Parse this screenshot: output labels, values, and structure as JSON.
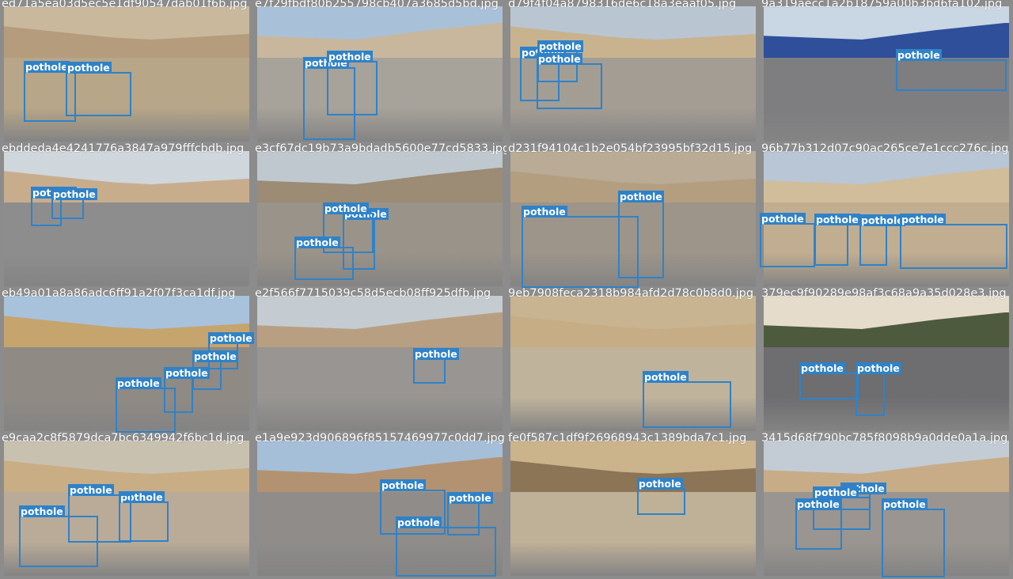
{
  "mosaic": {
    "tiles": [
      {
        "filename": "ed71a5ea03d5ec5e1df90547dab01f6b.jpg",
        "palette": {
          "sky": "#c9b89c",
          "wall": "#b49c7c",
          "road": "#b7a688"
        },
        "detections": [
          {
            "label": "pothole"
          },
          {
            "label": "pothole"
          }
        ]
      },
      {
        "filename": "e7f29fbdf80b255798cb407a3685d5bd.jpg",
        "palette": {
          "sky": "#a9c1d8",
          "wall": "#c8b79d",
          "road": "#a7a29a"
        },
        "detections": [
          {
            "label": "pothole"
          },
          {
            "label": "pothole"
          }
        ]
      },
      {
        "filename": "d79f4f04a8798316de6c18a3eaaf05.jpg",
        "palette": {
          "sky": "#b9c6d2",
          "wall": "#c9b38f",
          "road": "#a39d94"
        },
        "detections": [
          {
            "label": "pothole"
          },
          {
            "label": "pothole"
          },
          {
            "label": "pothole"
          }
        ]
      },
      {
        "filename": "9a319aecc1a2b18759a00b3bd6fa102.jpg",
        "palette": {
          "sky": "#c9d6e3",
          "wall": "#2f4f9a",
          "road": "#7e7e80"
        },
        "detections": [
          {
            "label": "pothole"
          }
        ]
      },
      {
        "filename": "ebddeda4e4241776a3847a979fffcbdb.jpg",
        "palette": {
          "sky": "#cfd6dc",
          "wall": "#c8ad8c",
          "road": "#8e8d8d"
        },
        "detections": [
          {
            "label": "pothole"
          },
          {
            "label": "pothole"
          }
        ]
      },
      {
        "filename": "e3cf67dc19b73a9bdadb5600e77cd5833.jpg",
        "palette": {
          "sky": "#bfc8cf",
          "wall": "#9c8b75",
          "road": "#9a9389"
        },
        "detections": [
          {
            "label": "pothole"
          },
          {
            "label": "pothole"
          },
          {
            "label": "pothole"
          }
        ]
      },
      {
        "filename": "d231f94104c1b2e054bf23995bf32d15.jpg",
        "palette": {
          "sky": "#b9ab95",
          "wall": "#b39e80",
          "road": "#9d958a"
        },
        "detections": [
          {
            "label": "pothole"
          },
          {
            "label": "pothole"
          }
        ]
      },
      {
        "filename": "96b77b312d07c90ac265ce7e1ccc276c.jpg",
        "palette": {
          "sky": "#b8c6d5",
          "wall": "#d2bd9b",
          "road": "#c1ae91"
        },
        "detections": [
          {
            "label": "pothole"
          },
          {
            "label": "pothole"
          },
          {
            "label": "pothole"
          },
          {
            "label": "pothole"
          }
        ]
      },
      {
        "filename": "eb49a01a8a86adc6ff91a2f07f3ca1df.jpg",
        "palette": {
          "sky": "#a8c2dc",
          "wall": "#c6a46e",
          "road": "#8f8a84"
        },
        "detections": [
          {
            "label": "pothole"
          },
          {
            "label": "pothole"
          },
          {
            "label": "pothole"
          },
          {
            "label": "pothole"
          }
        ]
      },
      {
        "filename": "e2f566f7715039c58d5ecb08ff925dfb.jpg",
        "palette": {
          "sky": "#c4ccd2",
          "wall": "#b99f82",
          "road": "#989592"
        },
        "detections": [
          {
            "label": "pothole"
          }
        ]
      },
      {
        "filename": "9eb7908feca2318b984afd2d78c0b8d0.jpg",
        "palette": {
          "sky": "#c9b491",
          "wall": "#c6ad86",
          "road": "#c0b39b"
        },
        "detections": [
          {
            "label": "pothole"
          }
        ]
      },
      {
        "filename": "379ec9f90289e98af3c68a9a35d028e3.jpg",
        "palette": {
          "sky": "#e6dccb",
          "wall": "#4e5a3e",
          "road": "#6e6d6f"
        },
        "detections": [
          {
            "label": "pothole"
          },
          {
            "label": "pothole"
          }
        ]
      },
      {
        "filename": "e9caa2c8f5879dca7bc6349942f6bc1d.jpg",
        "palette": {
          "sky": "#c9c1b0",
          "wall": "#c9ad85",
          "road": "#b9ab98"
        },
        "detections": [
          {
            "label": "pothole"
          },
          {
            "label": "pothole"
          },
          {
            "label": "pothole"
          }
        ]
      },
      {
        "filename": "e1a9e923d906896f85157469977c0dd7.jpg",
        "palette": {
          "sky": "#a5bfd8",
          "wall": "#b39272",
          "road": "#8f8c89"
        },
        "detections": [
          {
            "label": "pothole"
          },
          {
            "label": "pothole"
          },
          {
            "label": "pothole"
          }
        ]
      },
      {
        "filename": "fe0f587c1df9f26968943c1389bda7c1.jpg",
        "palette": {
          "sky": "#cbb38c",
          "wall": "#8c7556",
          "road": "#bfb098"
        },
        "detections": [
          {
            "label": "pothole"
          }
        ]
      },
      {
        "filename": "3415d68f790bc785f8098b9a0dde0a1a.jpg",
        "palette": {
          "sky": "#c3ccd4",
          "wall": "#c8ac88",
          "road": "#9a9590"
        },
        "detections": [
          {
            "label": "pothole"
          },
          {
            "label": "pothole"
          },
          {
            "label": "pothole"
          },
          {
            "label": "pothole"
          }
        ]
      }
    ]
  }
}
